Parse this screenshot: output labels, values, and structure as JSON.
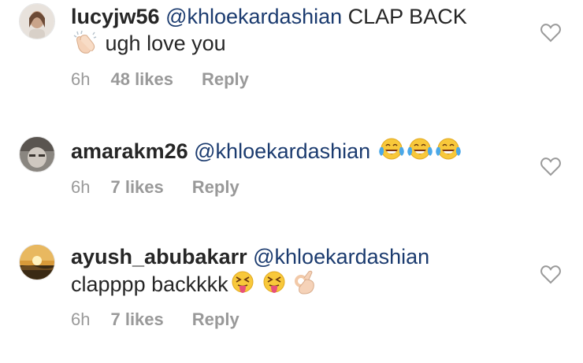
{
  "comments": [
    {
      "username": "lucyjw56",
      "mention": "@khloekardashian",
      "text": "CLAP BACK",
      "text2": "ugh love you",
      "emojis": [
        "clapping-hands"
      ],
      "time": "6h",
      "likes": "48 likes",
      "reply": "Reply"
    },
    {
      "username": "amarakm26",
      "mention": "@khloekardashian",
      "text": "",
      "emojis": [
        "face-with-tears-of-joy",
        "face-with-tears-of-joy",
        "face-with-tears-of-joy"
      ],
      "time": "6h",
      "likes": "7 likes",
      "reply": "Reply"
    },
    {
      "username": "ayush_abubakarr",
      "mention": "@khloekardashian",
      "text": "clapppp backkkk",
      "emojis": [
        "squinting-face-with-tongue",
        "squinting-face-with-tongue",
        "ok-hand"
      ],
      "time": "6h",
      "likes": "7 likes",
      "reply": "Reply"
    }
  ],
  "colors": {
    "mention": "#1b3b6f",
    "meta": "#999999",
    "text": "#262626"
  }
}
